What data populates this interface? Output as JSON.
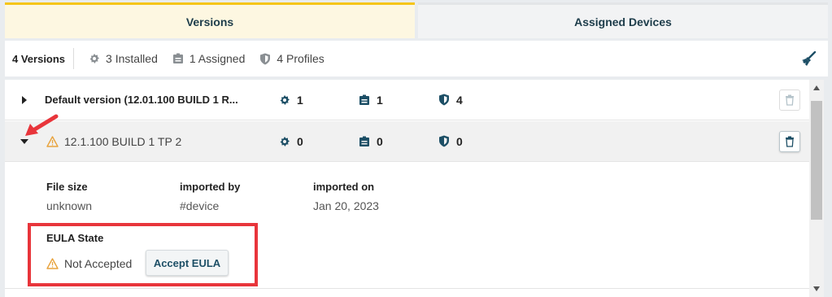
{
  "tabs": [
    {
      "label": "Versions",
      "active": true
    },
    {
      "label": "Assigned Devices",
      "active": false
    }
  ],
  "summary": {
    "versions_count": "4 Versions",
    "installed": "3 Installed",
    "assigned": "1 Assigned",
    "profiles": "4 Profiles"
  },
  "rows": [
    {
      "name": "Default version (12.01.100 BUILD 1 R...",
      "installed": "1",
      "assigned": "1",
      "profiles": "4",
      "expanded": false
    },
    {
      "name": "12.1.100 BUILD 1 TP 2",
      "installed": "0",
      "assigned": "0",
      "profiles": "0",
      "expanded": true,
      "warning": true
    }
  ],
  "details": {
    "file_size_label": "File size",
    "file_size_value": "unknown",
    "imported_by_label": "imported by",
    "imported_by_value": "#device",
    "imported_on_label": "imported on",
    "imported_on_value": "Jan 20, 2023",
    "eula_label": "EULA State",
    "eula_value": "Not Accepted",
    "accept_button": "Accept EULA"
  },
  "colors": {
    "accent_yellow": "#f5c518",
    "icon_teal": "#1d4f66",
    "warning": "#e8a33d",
    "annotation_red": "#e8353b"
  },
  "icons": {
    "installed": "puzzle-gear-icon",
    "assigned": "clipboard-icon",
    "profiles": "shield-icon",
    "clean": "broom-icon",
    "delete": "trash-icon",
    "warning": "warning-triangle-icon"
  }
}
